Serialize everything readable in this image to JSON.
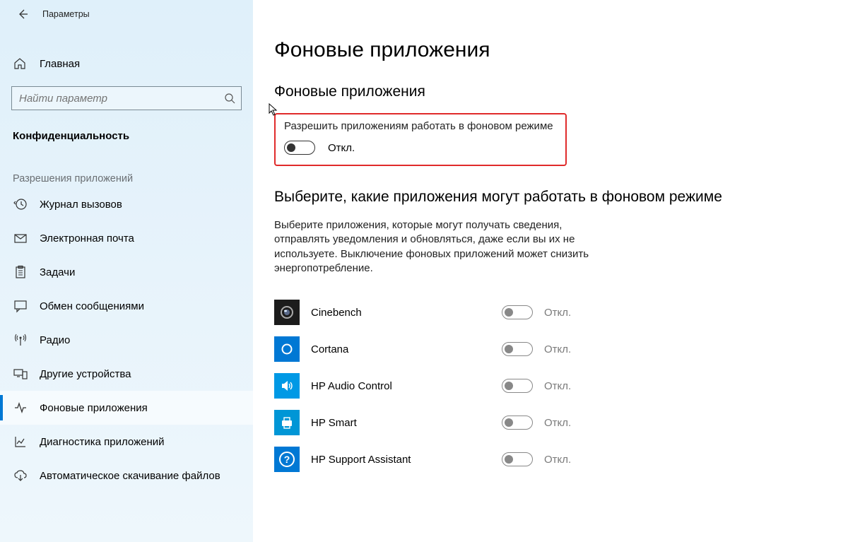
{
  "sidebar": {
    "title": "Параметры",
    "home": "Главная",
    "search_placeholder": "Найти параметр",
    "section": "Конфиденциальность",
    "subsection": "Разрешения приложений",
    "items": [
      {
        "label": "Журнал вызовов"
      },
      {
        "label": "Электронная почта"
      },
      {
        "label": "Задачи"
      },
      {
        "label": "Обмен сообщениями"
      },
      {
        "label": "Радио"
      },
      {
        "label": "Другие устройства"
      },
      {
        "label": "Фоновые приложения"
      },
      {
        "label": "Диагностика приложений"
      },
      {
        "label": "Автоматическое скачивание файлов"
      }
    ]
  },
  "content": {
    "page_title": "Фоновые приложения",
    "section1_title": "Фоновые приложения",
    "master_toggle_label": "Разрешить приложениям работать в фоновом режиме",
    "master_toggle_state": "Откл.",
    "section2_title": "Выберите, какие приложения могут работать в фоновом режиме",
    "description": "Выберите приложения, которые могут получать сведения, отправлять уведомления и обновляться, даже если вы их не используете. Выключение фоновых приложений может снизить энергопотребление.",
    "apps": [
      {
        "name": "Cinebench",
        "state": "Откл.",
        "icon": "camera",
        "bg": "#1c1c1c"
      },
      {
        "name": "Cortana",
        "state": "Откл.",
        "icon": "circle",
        "bg": "#0078d4"
      },
      {
        "name": "HP Audio Control",
        "state": "Откл.",
        "icon": "speaker",
        "bg": "#0099e5"
      },
      {
        "name": "HP Smart",
        "state": "Откл.",
        "icon": "printer",
        "bg": "#0096d6"
      },
      {
        "name": "HP Support Assistant",
        "state": "Откл.",
        "icon": "help",
        "bg": "#0078d4"
      }
    ]
  }
}
